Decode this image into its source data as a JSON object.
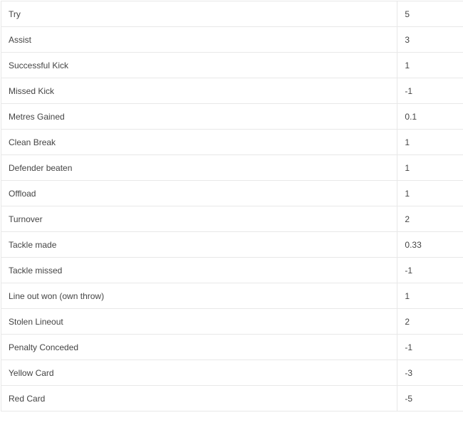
{
  "table": {
    "rows": [
      {
        "action": "Try",
        "points": "5"
      },
      {
        "action": "Assist",
        "points": "3"
      },
      {
        "action": "Successful Kick",
        "points": "1"
      },
      {
        "action": "Missed Kick",
        "points": "-1"
      },
      {
        "action": "Metres Gained",
        "points": "0.1"
      },
      {
        "action": "Clean Break",
        "points": "1"
      },
      {
        "action": "Defender beaten",
        "points": "1"
      },
      {
        "action": "Offload",
        "points": "1"
      },
      {
        "action": "Turnover",
        "points": "2"
      },
      {
        "action": "Tackle made",
        "points": "0.33"
      },
      {
        "action": "Tackle missed",
        "points": "-1"
      },
      {
        "action": "Line out won (own throw)",
        "points": "1"
      },
      {
        "action": "Stolen Lineout",
        "points": "2"
      },
      {
        "action": "Penalty Conceded",
        "points": "-1"
      },
      {
        "action": "Yellow Card",
        "points": "-3"
      },
      {
        "action": "Red Card",
        "points": "-5"
      }
    ]
  },
  "colors": {
    "text": "#444444",
    "border": "#e8e8e8",
    "background": "#ffffff"
  }
}
